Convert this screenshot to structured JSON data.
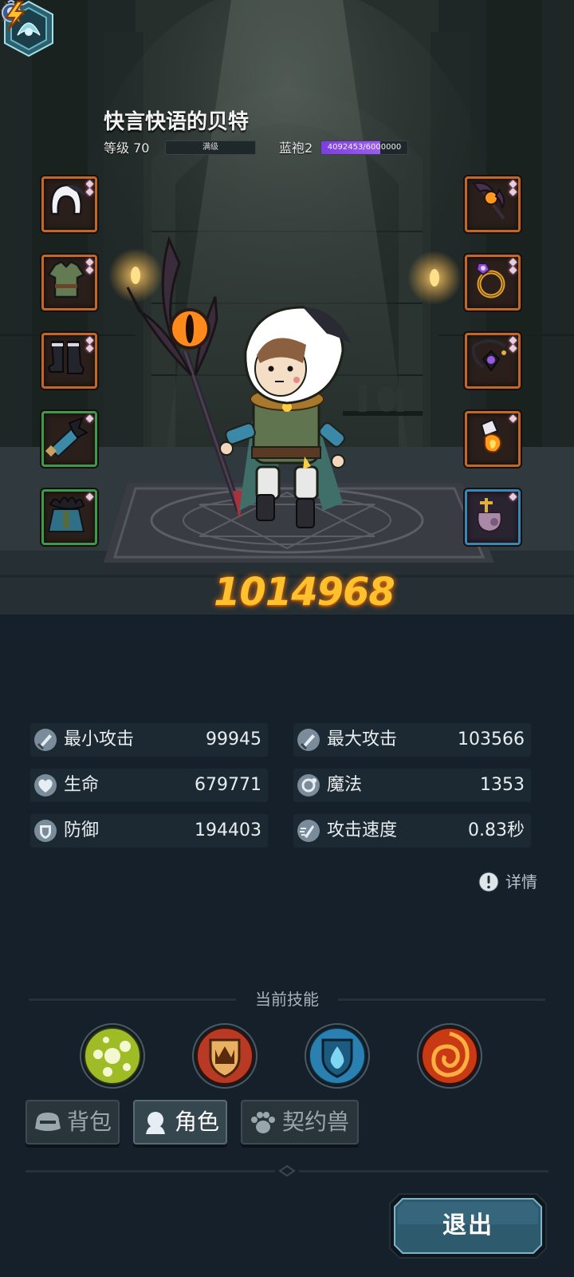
{
  "player": {
    "name": "快言快语的贝特",
    "level_label": "等级 70",
    "level_bar_text": "满级",
    "rank_label": "蓝袍2",
    "rank_progress_text": "4092453/6000000",
    "rank_progress_fraction": 0.682
  },
  "equipment": {
    "left": [
      {
        "name": "hood",
        "rarity": "orange"
      },
      {
        "name": "tunic",
        "rarity": "orange"
      },
      {
        "name": "boots",
        "rarity": "orange"
      },
      {
        "name": "bracer",
        "rarity": "green"
      },
      {
        "name": "cloak",
        "rarity": "green"
      }
    ],
    "right": [
      {
        "name": "staff",
        "rarity": "orange"
      },
      {
        "name": "ring",
        "rarity": "orange"
      },
      {
        "name": "amulet",
        "rarity": "orange"
      },
      {
        "name": "fire-gem",
        "rarity": "orange"
      },
      {
        "name": "pet-relic",
        "rarity": "blue"
      }
    ]
  },
  "power": {
    "value": "1014968"
  },
  "stats": [
    {
      "icon": "sword-icon",
      "label": "最小攻击",
      "value": "99945"
    },
    {
      "icon": "sword-icon",
      "label": "最大攻击",
      "value": "103566"
    },
    {
      "icon": "heart-icon",
      "label": "生命",
      "value": "679771"
    },
    {
      "icon": "magic-orb-icon",
      "label": "魔法",
      "value": "1353"
    },
    {
      "icon": "shield-icon",
      "label": "防御",
      "value": "194403"
    },
    {
      "icon": "speed-icon",
      "label": "攻击速度",
      "value": "0.83秒"
    }
  ],
  "details_label": "详情",
  "skills": {
    "title": "当前技能",
    "items": [
      {
        "name": "green-orbs-skill",
        "color": "#a5c52e"
      },
      {
        "name": "crown-shield-skill",
        "color": "#c94a2a"
      },
      {
        "name": "water-shield-skill",
        "color": "#2f86b8"
      },
      {
        "name": "fire-swirl-skill",
        "color": "#d6441a"
      }
    ]
  },
  "tabs": [
    {
      "label": "背包",
      "icon": "bag-icon",
      "active": false
    },
    {
      "label": "角色",
      "icon": "character-icon",
      "active": true
    },
    {
      "label": "契约兽",
      "icon": "paw-icon",
      "active": false
    }
  ],
  "exit_label": "退出",
  "colors": {
    "power": "#ffc12e",
    "rank_bar": "#8e4ce8",
    "panel_bg": "#15202a"
  }
}
